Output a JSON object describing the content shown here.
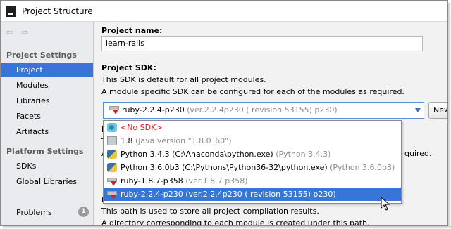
{
  "window": {
    "title": "Project Structure"
  },
  "sidebar": {
    "project_settings_header": "Project Settings",
    "project_settings_items": [
      {
        "label": "Project",
        "selected": true
      },
      {
        "label": "Modules"
      },
      {
        "label": "Libraries"
      },
      {
        "label": "Facets"
      },
      {
        "label": "Artifacts"
      }
    ],
    "platform_settings_header": "Platform Settings",
    "platform_settings_items": [
      {
        "label": "SDKs"
      },
      {
        "label": "Global Libraries"
      }
    ],
    "problems": {
      "label": "Problems",
      "count": "1"
    }
  },
  "main": {
    "project_name_label": "Project name:",
    "project_name_value": "learn-rails",
    "project_sdk_label": "Project SDK:",
    "sdk_desc_1": "This SDK is default for all project modules.",
    "sdk_desc_2": "A module specific SDK can be configured for each of the modules as required.",
    "sdk_selected": "ruby-2.2.4-p230",
    "sdk_selected_detail": "(ver.2.2.4p230 ( revision 53155) p230)",
    "new_button": "New...",
    "occluded": {
      "p": "P",
      "t": "T",
      "a": "A",
      "quired": "quired.",
      "f": "F"
    },
    "output_desc_1": "This path is used to store all project compilation results.",
    "output_desc_2": "A directory corresponding to each module is created under this path."
  },
  "sdk_dropdown": {
    "options": [
      {
        "name": "<No SDK>",
        "detail": "",
        "icon": "no-sdk-icon"
      },
      {
        "name": "1.8",
        "detail": "(java version \"1.8.0_60\")",
        "icon": "java-sdk-icon"
      },
      {
        "name": "Python 3.4.3 (C:\\Anaconda\\python.exe)",
        "detail": "(Python 3.4.3)",
        "icon": "python-icon"
      },
      {
        "name": "Python 3.6.0b3 (C:\\Pythons\\Python36-32\\python.exe)",
        "detail": "(Python 3.6.0b3)",
        "icon": "python-icon"
      },
      {
        "name": "ruby-1.8.7-p358",
        "detail": "(ver.1.8.7 p358)",
        "icon": "ruby-icon"
      },
      {
        "name": "ruby-2.2.4-p230 (ver.2.2.4p230 ( revision 53155) p230)",
        "detail": "",
        "icon": "ruby-icon",
        "selected": true
      }
    ]
  },
  "colors": {
    "selection": "#3875d6",
    "no_sdk_red": "#d61c1c",
    "muted_gray": "#8c8c8c"
  }
}
